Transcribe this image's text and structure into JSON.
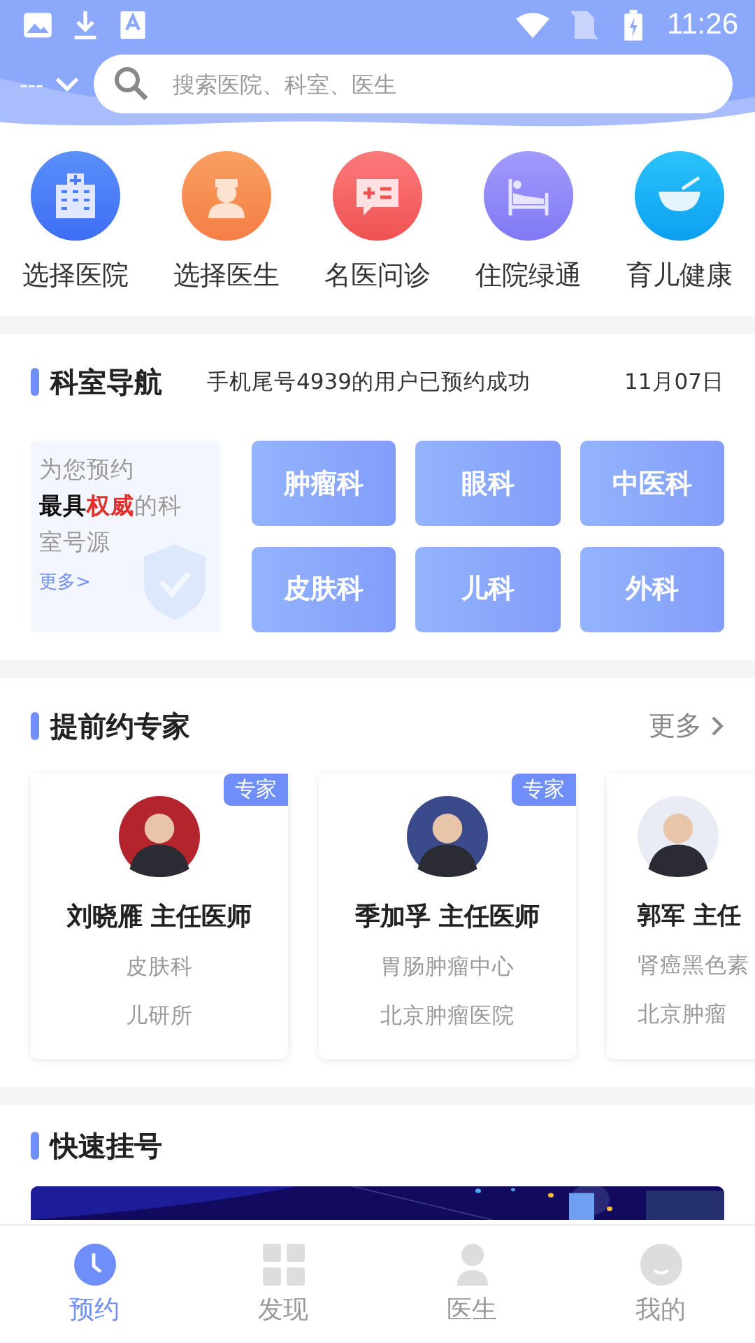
{
  "status_bar": {
    "time": "11:26"
  },
  "header": {
    "location": "---",
    "search": {
      "placeholder": "搜索医院、科室、医生"
    }
  },
  "quick_actions": [
    {
      "kind": "hospital",
      "label": "选择医院"
    },
    {
      "kind": "nurse",
      "label": "选择医生"
    },
    {
      "kind": "chat",
      "label": "名医问诊"
    },
    {
      "kind": "bed",
      "label": "住院绿通"
    },
    {
      "kind": "bowl",
      "label": "育儿健康"
    }
  ],
  "department_nav": {
    "title": "科室导航",
    "notice": "手机尾号4939的用户已预约成功",
    "date": "11月07日",
    "promo": {
      "lead": "为您预约",
      "strong": "最具",
      "highlight": "权威",
      "tail": "的科室号源",
      "more": "更多>"
    },
    "departments": [
      "肿瘤科",
      "眼科",
      "中医科",
      "皮肤科",
      "儿科",
      "外科"
    ]
  },
  "experts": {
    "title": "提前约专家",
    "more": "更多",
    "cards": [
      {
        "kind": "full",
        "badge": "专家",
        "name": "刘晓雁 主任医师",
        "department": "皮肤科",
        "hospital": "儿研所"
      },
      {
        "kind": "full",
        "badge": "专家",
        "name": "季加孚 主任医师",
        "department": "胃肠肿瘤中心",
        "hospital": "北京肿瘤医院"
      },
      {
        "kind": "partial",
        "name": "郭军 主任",
        "department": "肾癌黑色素",
        "hospital": "北京肿瘤"
      }
    ]
  },
  "quick_register": {
    "title": "快速挂号"
  },
  "tab_bar": [
    {
      "kind": "clock",
      "label": "预约",
      "selected": true
    },
    {
      "kind": "grid",
      "label": "发现",
      "selected": false
    },
    {
      "kind": "person",
      "label": "医生",
      "selected": false
    },
    {
      "kind": "smile",
      "label": "我的",
      "selected": false
    }
  ]
}
